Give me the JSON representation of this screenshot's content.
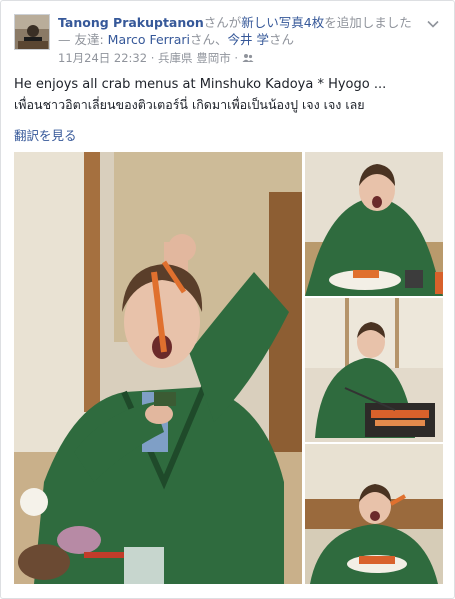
{
  "post": {
    "author": "Tanong Prakuptanon",
    "action": "さんが",
    "action_link": "新しい写真4枚",
    "action_tail": "を追加しました — 友達: ",
    "friend1": "Marco Ferrari",
    "friend_sep": "さん、",
    "friend2": "今井 学",
    "friend_tail": "さん",
    "date": "11月24日 22:32",
    "location_sep": " · ",
    "location": "兵庫県 豊岡市",
    "location_tail": " · ",
    "caption_en": "He enjoys all crab menus at Minshuko Kadoya * Hyogo ...",
    "caption_th": "เพื่อนชาวอิตาเลี่ยนของติวเตอร์นี่ เกิดมาเพื่อเป็นน้องปู เจง เจง เลย",
    "translate": "翻訳を見る"
  },
  "icons": {
    "privacy": "friends-icon",
    "menu": "chevron-down-icon"
  }
}
